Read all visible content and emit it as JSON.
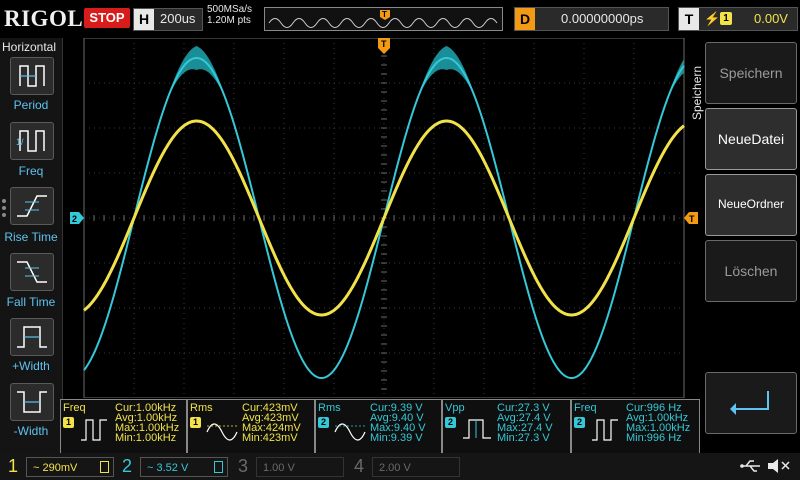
{
  "topbar": {
    "logo": "RIGOL",
    "run_state": "STOP",
    "h_label": "H",
    "timebase": "200us",
    "sample_rate": "500MSa/s",
    "points": "1.20M pts",
    "d_label": "D",
    "delay": "0.00000000ps",
    "t_label": "T",
    "trigger_source": "1",
    "trigger_level": "0.00V"
  },
  "left_panel": {
    "title": "Horizontal",
    "items": [
      {
        "label": "Period"
      },
      {
        "label": "Freq"
      },
      {
        "label": "Rise Time"
      },
      {
        "label": "Fall Time"
      },
      {
        "label": "+Width"
      },
      {
        "label": "-Width"
      }
    ]
  },
  "right_panel": {
    "title": "Speichern",
    "buttons": [
      {
        "label": "Speichern"
      },
      {
        "label": "NeueDatei"
      },
      {
        "label": "NeueOrdner"
      },
      {
        "label": "Löschen"
      }
    ]
  },
  "markers": {
    "trigger_pos": "T",
    "ch2_ground": "2",
    "trigger_level": "T"
  },
  "measurements": [
    {
      "name": "Freq",
      "channel": "1",
      "cur": "Cur:1.00kHz",
      "avg": "Avg:1.00kHz",
      "max": "Max:1.00kHz",
      "min": "Min:1.00kHz",
      "icon": "freq-icon"
    },
    {
      "name": "Rms",
      "channel": "1",
      "cur": "Cur:423mV",
      "avg": "Avg:423mV",
      "max": "Max:424mV",
      "min": "Min:423mV",
      "icon": "rms-icon"
    },
    {
      "name": "Rms",
      "channel": "2",
      "cur": "Cur:9.39 V",
      "avg": "Avg:9.40 V",
      "max": "Max:9.40 V",
      "min": "Min:9.39 V",
      "icon": "rms-icon"
    },
    {
      "name": "Vpp",
      "channel": "2",
      "cur": "Cur:27.3 V",
      "avg": "Avg:27.4 V",
      "max": "Max:27.4 V",
      "min": "Min:27.3 V",
      "icon": "vpp-icon"
    },
    {
      "name": "Freq",
      "channel": "2",
      "cur": "Cur:996 Hz",
      "avg": "Avg:1.00kHz",
      "max": "Max:1.00kHz",
      "min": "Min:996 Hz",
      "icon": "freq-icon"
    }
  ],
  "channels": [
    {
      "num": "1",
      "scale": "~ 290mV",
      "color": "#f2e24a",
      "active": true
    },
    {
      "num": "2",
      "scale": "~ 3.52 V",
      "color": "#34c8d8",
      "active": true
    },
    {
      "num": "3",
      "scale": "1.00 V",
      "color": "#d85fbf",
      "active": false
    },
    {
      "num": "4",
      "scale": "2.00 V",
      "color": "#3a5fd8",
      "active": false
    }
  ],
  "colors": {
    "ch1": "#f2e24a",
    "ch2": "#34c8d8",
    "accent": "#f39a14",
    "stop": "#d81c1c"
  }
}
